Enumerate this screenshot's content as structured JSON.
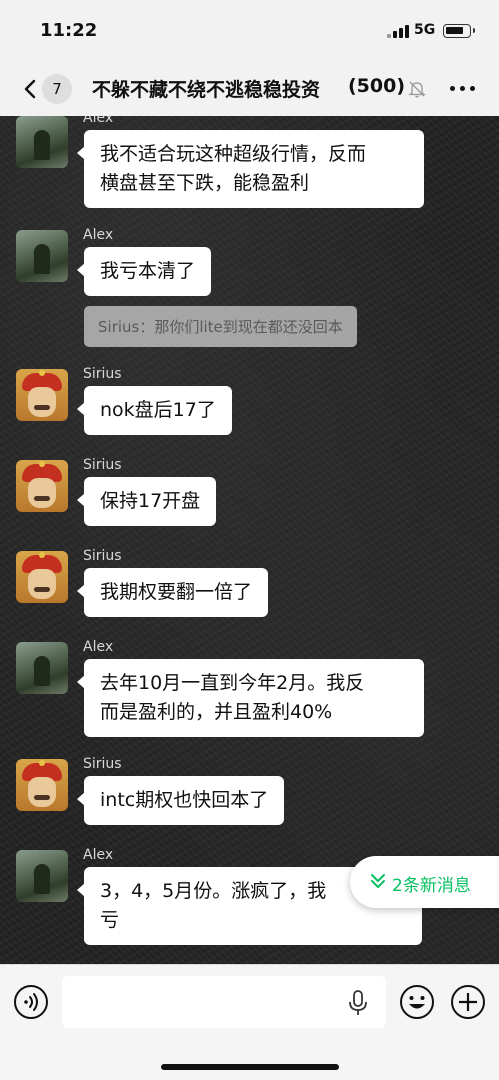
{
  "status_bar": {
    "time": "11:22",
    "network": "5G"
  },
  "header": {
    "unread_count": "7",
    "title": "不躲不藏不绕不逃稳稳投资",
    "member_count": "(500)"
  },
  "messages": [
    {
      "sender": "Alex",
      "avatar": "alex",
      "lines": [
        "我不适合玩这种超级行情，反而",
        "横盘甚至下跌，能稳盈利"
      ]
    },
    {
      "sender": "Alex",
      "avatar": "alex",
      "lines": [
        "我亏本清了"
      ],
      "quote": "Sirius：那你们lite到现在都还没回本"
    },
    {
      "sender": "Sirius",
      "avatar": "sirius",
      "lines": [
        "nok盘后17了"
      ]
    },
    {
      "sender": "Sirius",
      "avatar": "sirius",
      "lines": [
        "保持17开盘"
      ]
    },
    {
      "sender": "Sirius",
      "avatar": "sirius",
      "lines": [
        "我期权要翻一倍了"
      ]
    },
    {
      "sender": "Alex",
      "avatar": "alex",
      "lines": [
        "去年10月一直到今年2月。我反",
        "而是盈利的，并且盈利40%"
      ]
    },
    {
      "sender": "Sirius",
      "avatar": "sirius",
      "lines": [
        "intc期权也快回本了"
      ]
    },
    {
      "sender": "Alex",
      "avatar": "alex",
      "lines": [
        "3，4，5月份。涨疯了，我",
        "亏"
      ]
    }
  ],
  "new_messages_pill": {
    "label": "2条新消息",
    "color": "#07c160"
  },
  "input_bar": {
    "placeholder": ""
  },
  "icons": [
    "back-chevron-icon",
    "mute-bell-icon",
    "more-dots-icon",
    "voice-icon",
    "mic-icon",
    "emoji-icon",
    "plus-icon"
  ]
}
